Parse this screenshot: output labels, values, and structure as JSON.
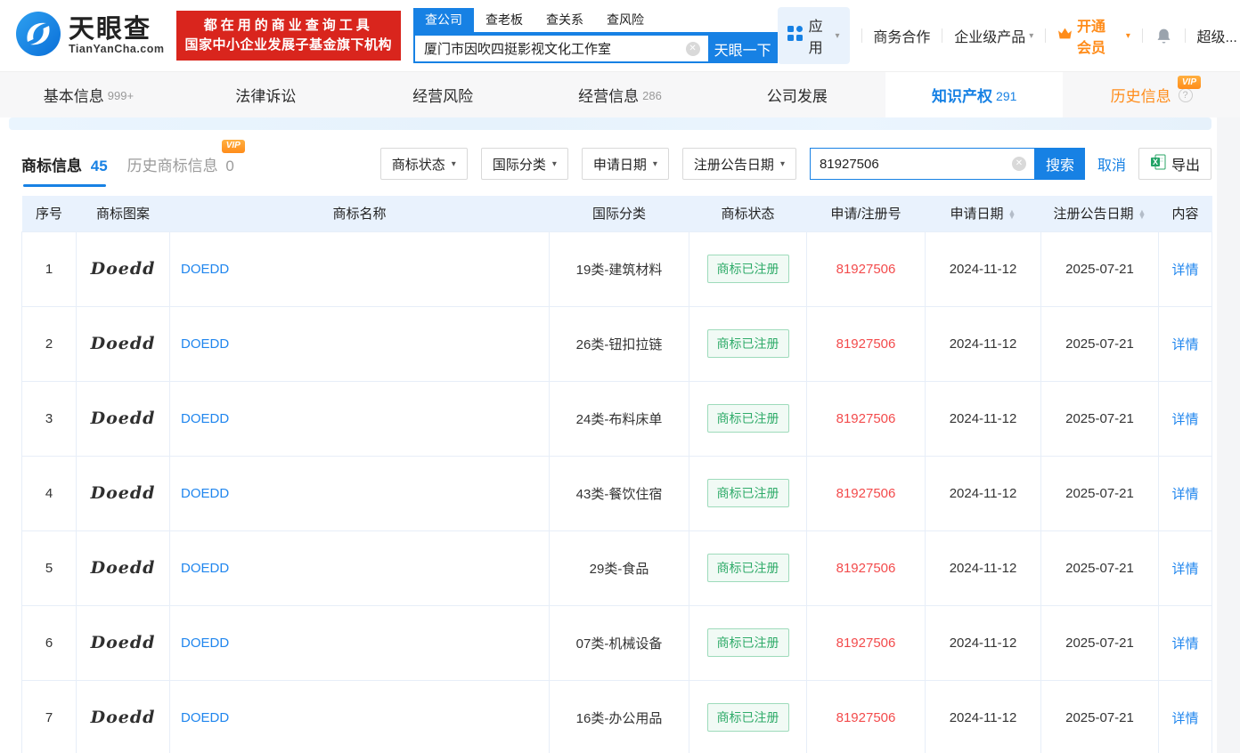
{
  "icons": {
    "clear_icon": "✕",
    "caret_icon": "▾",
    "help_icon": "?",
    "sort_up_icon": "▲",
    "sort_down_icon": "▼",
    "vip_badge": "VIP"
  },
  "colors": {
    "accent_blue": "#1781e4",
    "link_blue": "#2086ee",
    "banner_red": "#d9251d",
    "number_red": "#f34b4c",
    "status_green": "#2fab69",
    "vip_orange": "#ff8c1a",
    "table_header_bg": "#e9f2fd"
  },
  "header": {
    "logo": {
      "title": "天眼查",
      "domain": "TianYanCha.com"
    },
    "banner": {
      "line1": "都在用的商业查询工具",
      "line2": "国家中小企业发展子基金旗下机构"
    },
    "search": {
      "tabs": [
        {
          "label": "查公司"
        },
        {
          "label": "查老板"
        },
        {
          "label": "查关系"
        },
        {
          "label": "查风险"
        }
      ],
      "value": "厦门市因吹四挺影视文化工作室",
      "button": "天眼一下"
    },
    "nav": {
      "apps": "应用",
      "cooperation": "商务合作",
      "enterprise": "企业级产品",
      "vip": "开通会员",
      "more": "超级..."
    }
  },
  "tabs": [
    {
      "label": "基本信息",
      "count": "999+"
    },
    {
      "label": "法律诉讼",
      "count": ""
    },
    {
      "label": "经营风险",
      "count": ""
    },
    {
      "label": "经营信息",
      "count": "286"
    },
    {
      "label": "公司发展",
      "count": ""
    },
    {
      "label": "知识产权",
      "count": "291"
    },
    {
      "label": "历史信息",
      "count": ""
    }
  ],
  "subtabs": {
    "trademark": {
      "label": "商标信息",
      "count": "45"
    },
    "history": {
      "label": "历史商标信息",
      "count": "0"
    }
  },
  "filters": {
    "dropdowns": [
      "商标状态",
      "国际分类",
      "申请日期",
      "注册公告日期"
    ],
    "search_value": "81927506",
    "search_button": "搜索",
    "cancel": "取消",
    "export": "导出"
  },
  "table": {
    "columns": [
      "序号",
      "商标图案",
      "商标名称",
      "国际分类",
      "商标状态",
      "申请/注册号",
      "申请日期",
      "注册公告日期",
      "内容"
    ],
    "rows": [
      {
        "no": "1",
        "image_text": "Doedd",
        "name": "DOEDD",
        "intl_class": "19类-建筑材料",
        "status": "商标已注册",
        "reg_no": "81927506",
        "apply_date": "2024-11-12",
        "publish_date": "2025-07-21",
        "action": "详情"
      },
      {
        "no": "2",
        "image_text": "Doedd",
        "name": "DOEDD",
        "intl_class": "26类-钮扣拉链",
        "status": "商标已注册",
        "reg_no": "81927506",
        "apply_date": "2024-11-12",
        "publish_date": "2025-07-21",
        "action": "详情"
      },
      {
        "no": "3",
        "image_text": "Doedd",
        "name": "DOEDD",
        "intl_class": "24类-布料床单",
        "status": "商标已注册",
        "reg_no": "81927506",
        "apply_date": "2024-11-12",
        "publish_date": "2025-07-21",
        "action": "详情"
      },
      {
        "no": "4",
        "image_text": "Doedd",
        "name": "DOEDD",
        "intl_class": "43类-餐饮住宿",
        "status": "商标已注册",
        "reg_no": "81927506",
        "apply_date": "2024-11-12",
        "publish_date": "2025-07-21",
        "action": "详情"
      },
      {
        "no": "5",
        "image_text": "Doedd",
        "name": "DOEDD",
        "intl_class": "29类-食品",
        "status": "商标已注册",
        "reg_no": "81927506",
        "apply_date": "2024-11-12",
        "publish_date": "2025-07-21",
        "action": "详情"
      },
      {
        "no": "6",
        "image_text": "Doedd",
        "name": "DOEDD",
        "intl_class": "07类-机械设备",
        "status": "商标已注册",
        "reg_no": "81927506",
        "apply_date": "2024-11-12",
        "publish_date": "2025-07-21",
        "action": "详情"
      },
      {
        "no": "7",
        "image_text": "Doedd",
        "name": "DOEDD",
        "intl_class": "16类-办公用品",
        "status": "商标已注册",
        "reg_no": "81927506",
        "apply_date": "2024-11-12",
        "publish_date": "2025-07-21",
        "action": "详情"
      }
    ]
  }
}
